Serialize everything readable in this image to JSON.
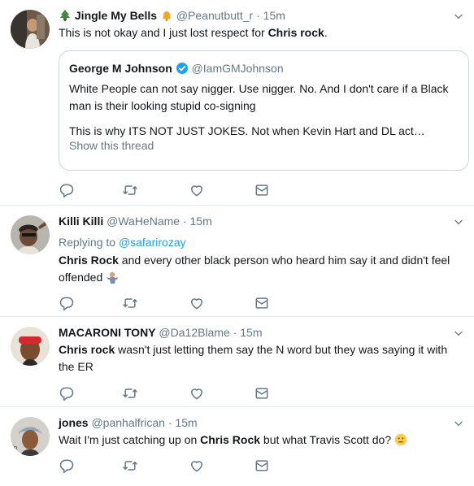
{
  "tweets": [
    {
      "name": "Jingle My Bells",
      "handle": "@Peanutbutt_r",
      "sep": "·",
      "time": "15m",
      "text_pre": "This is not okay and I just lost respect for ",
      "text_bold": "Chris rock",
      "text_post": ".",
      "quote": {
        "name": "George M Johnson",
        "handle": "@IamGMJohnson",
        "line1": "White People can not say nigger. Use nigger. No. And I don't care if a Black man is their looking stupid co-signing",
        "line2": "This is why ITS NOT JUST JOKES. Not when Kevin Hart and DL act…",
        "show_thread": "Show this thread"
      }
    },
    {
      "name": "Killi Killi",
      "handle": "@WaHeName",
      "sep": "·",
      "time": "15m",
      "replying_label": "Replying to",
      "replying_to": "@safarirozay",
      "text_bold": "Chris Rock",
      "text_post": " and every other black person who heard him say it and didn't feel offended"
    },
    {
      "name": "MACARONI TONY",
      "handle": "@Da12Blame",
      "sep": "·",
      "time": "15m",
      "text_bold": "Chris rock",
      "text_post": " wasn't just letting them say the N word but they was saying it with the ER"
    },
    {
      "name": "jones",
      "handle": "@panhalfrican",
      "sep": "·",
      "time": "15m",
      "text_pre": "Wait I'm just catching up on ",
      "text_bold": "Chris Rock",
      "text_post": " but what Travis Scott do?"
    }
  ],
  "icons": [
    "reply-icon",
    "retweet-icon",
    "like-icon",
    "message-icon",
    "chevron-down-icon",
    "verified-badge-icon"
  ],
  "colors": {
    "text": "#14171a",
    "muted": "#657786",
    "link": "#1da1f2",
    "border": "#e6ecf0"
  }
}
